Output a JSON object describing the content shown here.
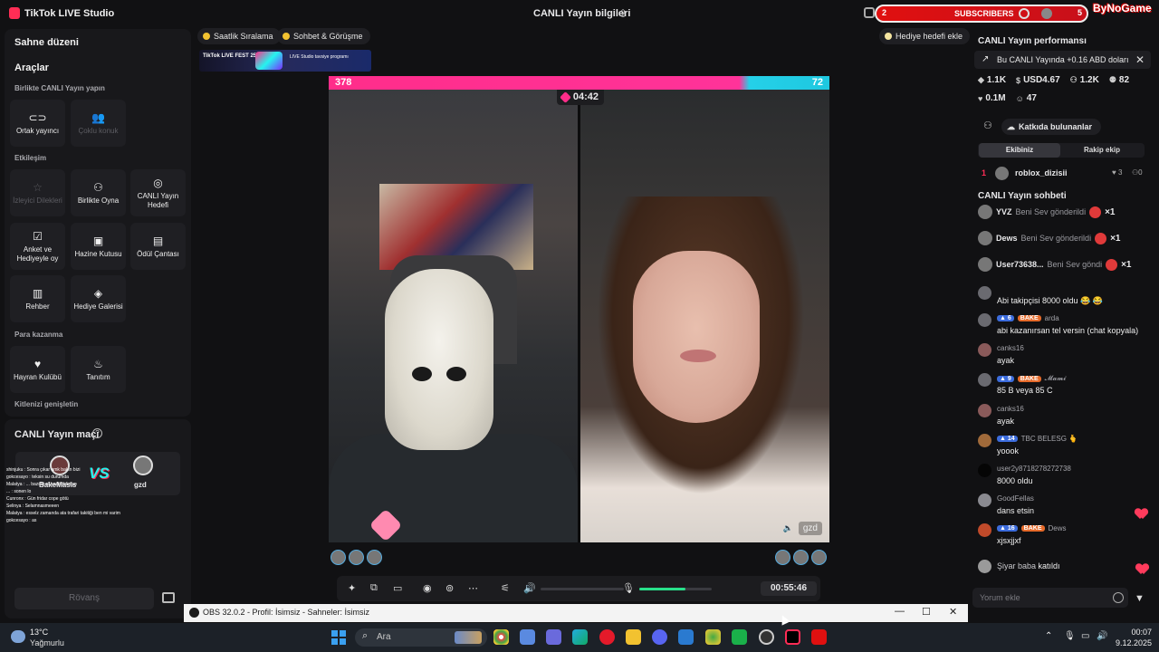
{
  "titlebar": {
    "app_name": "TikTok LIVE Studio",
    "live_info": "CANLI Yayın bilgileri",
    "subscribers_label": "SUBSCRIBERS",
    "subscribers_left": "2",
    "subscribers_right": "5",
    "channel_logo_text": "ByNoGame"
  },
  "left": {
    "scene_layout": "Sahne düzeni",
    "tools": "Araçlar",
    "section_together": "Birlikte CANLI Yayın yapın",
    "cohost": "Ortak yayıncı",
    "multi_guest": "Çoklu konuk",
    "section_engagement": "Etkileşim",
    "viewer_wishes": "İzleyici Dilekleri",
    "play_together": "Birlikte Oyna",
    "live_goal": "CANLI Yayın Hedefi",
    "poll": "Anket ve Hediyeyle oy",
    "treasure": "Hazine Kutusu",
    "reward_bag": "Ödül Çantası",
    "guide": "Rehber",
    "gift_gallery": "Hediye Galerisi",
    "section_monetize": "Para kazanma",
    "fan_club": "Hayran Kulübü",
    "promote": "Tanıtım",
    "section_expand": "Kitlenizi genişletin"
  },
  "match": {
    "title": "CANLI Yayın maçı",
    "player1": "BakeMasis",
    "player2": "gzd",
    "vs": "VS",
    "rematch": "Rövanş",
    "overlay_chat": [
      "shinjuku : Sonra çıkar amk bakın bizi",
      "gokcesayo : teksin su durumda",
      "Malatya : ... bazı bi el basti didirtiyo",
      "... : sonen lo",
      "Cunronx : Gün fridar cope götü",
      "Selinya : Selamnasmeeen",
      "Malatya : esselz zamanda ata trafari takitiği ben mi varim",
      "gokcesayo : as"
    ]
  },
  "center": {
    "hourly_ranking": "Saatlik Sıralama",
    "chat_meet": "Sohbet & Görüşme",
    "gift_goal": "Hediye hedefi ekle",
    "banner_title": "TikTok LIVE FEST 25",
    "banner_sub": "LIVE Studio tavsiye programı",
    "score_left": "378",
    "score_right": "72",
    "battle_timer": "04:42",
    "right_name": "gzd",
    "stream_time": "00:55:46",
    "mic_level": 0.64
  },
  "right": {
    "perf_title": "CANLI Yayın performansı",
    "earn_note": "Bu CANLI Yayında +0.16 ABD doları",
    "stats": [
      {
        "icon": "diamond-icon",
        "value": "1.1K"
      },
      {
        "icon": "coin-icon",
        "value": "USD4.67"
      },
      {
        "icon": "users-icon",
        "value": "1.2K"
      },
      {
        "icon": "people-icon",
        "value": "82"
      },
      {
        "icon": "heart-icon",
        "value": "0.1M"
      },
      {
        "icon": "viewer-icon",
        "value": "47"
      }
    ],
    "contributors": "Katkıda bulunanlar",
    "tab_our_team": "Ekibiniz",
    "tab_rival": "Rakip ekip",
    "rank_no": "1",
    "rank_name": "roblox_dizisii",
    "rank_likes": "3",
    "rank_gifts": "0",
    "chat_title": "CANLI Yayın sohbeti",
    "gift_events": [
      {
        "name": "YVZ",
        "action": "Beni Sev gönderildi",
        "count": "×1"
      },
      {
        "name": "Dews",
        "action": "Beni Sev gönderildi",
        "count": "×1"
      },
      {
        "name": "User73638...",
        "action": "Beni Sev göndi",
        "count": "×1"
      }
    ],
    "messages": [
      {
        "level": "",
        "fan": "",
        "user": "",
        "text": "Abi takipçisi 8000 oldu 😂 😂"
      },
      {
        "level": "6",
        "fan": "BAKE",
        "user": "arda",
        "text": "abi kazanırsan tel versin (chat kopyala)"
      },
      {
        "level": "",
        "fan": "",
        "user": "canks16",
        "text": "ayak"
      },
      {
        "level": "9",
        "fan": "BAKE",
        "user": "𝓜𝓪𝓶𝓲",
        "text": "85 B veya 85 C"
      },
      {
        "level": "",
        "fan": "",
        "user": "canks16",
        "text": "ayak"
      },
      {
        "level": "14",
        "fan": "",
        "user": "TBC BELESG 🫰",
        "text": "yoook"
      },
      {
        "level": "",
        "fan": "",
        "user": "user2y8718278272738",
        "text": "8000 oldu"
      },
      {
        "level": "",
        "fan": "",
        "user": "GoodFellas",
        "text": "dans etsin"
      },
      {
        "level": "16",
        "fan": "BAKE",
        "user": "Dews",
        "text": "xjsxjjxf"
      },
      {
        "level": "",
        "fan": "",
        "user": "Şiyar baba",
        "text": "katıldı"
      }
    ],
    "chat_placeholder": "Yorum ekle"
  },
  "obs": {
    "title": "OBS 32.0.2 - Profil: İsimsiz - Sahneler: İsimsiz"
  },
  "taskbar": {
    "temp": "13°C",
    "weather": "Yağmurlu",
    "search": "Ara",
    "time": "00:07",
    "date": "9.12.2025"
  }
}
